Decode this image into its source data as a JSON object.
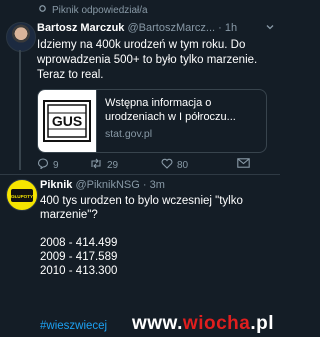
{
  "retweet": {
    "icon": "retweet-icon",
    "text": "Piknik odpowiedział/a"
  },
  "tweet1": {
    "name": "Bartosz Marczuk",
    "handle": "@BartoszMarcz...",
    "time": "· 1h",
    "text": "Idziemy na 400k urodzeń w tym roku. Do wprowadzenia 500+ to było tylko marzenie. Teraz to real.",
    "card": {
      "logo_text": "GUS",
      "title": "Wstępna informacja o urodzeniach w I półroczu...",
      "domain": "stat.gov.pl"
    },
    "actions": {
      "replies": "9",
      "retweets": "29",
      "likes": "80"
    }
  },
  "tweet2": {
    "name": "Piknik",
    "handle": "@PiknikNSG",
    "time": "· 3m",
    "avatar_text": "GŁUPOTY",
    "lines": [
      "400 tys urodzen to bylo wczesniej \"tylko marzenie\"?",
      "",
      "2008 - 414.499",
      "2009 - 417.589",
      "2010 - 413.300"
    ],
    "hashtag": "#wieszwiecej"
  },
  "watermark": {
    "left": "www.",
    "mid": "wiocha",
    "right": ".pl"
  },
  "colors": {
    "background": "#141d26",
    "muted": "#8899a6",
    "link": "#1da1f2",
    "border": "#38444d"
  }
}
